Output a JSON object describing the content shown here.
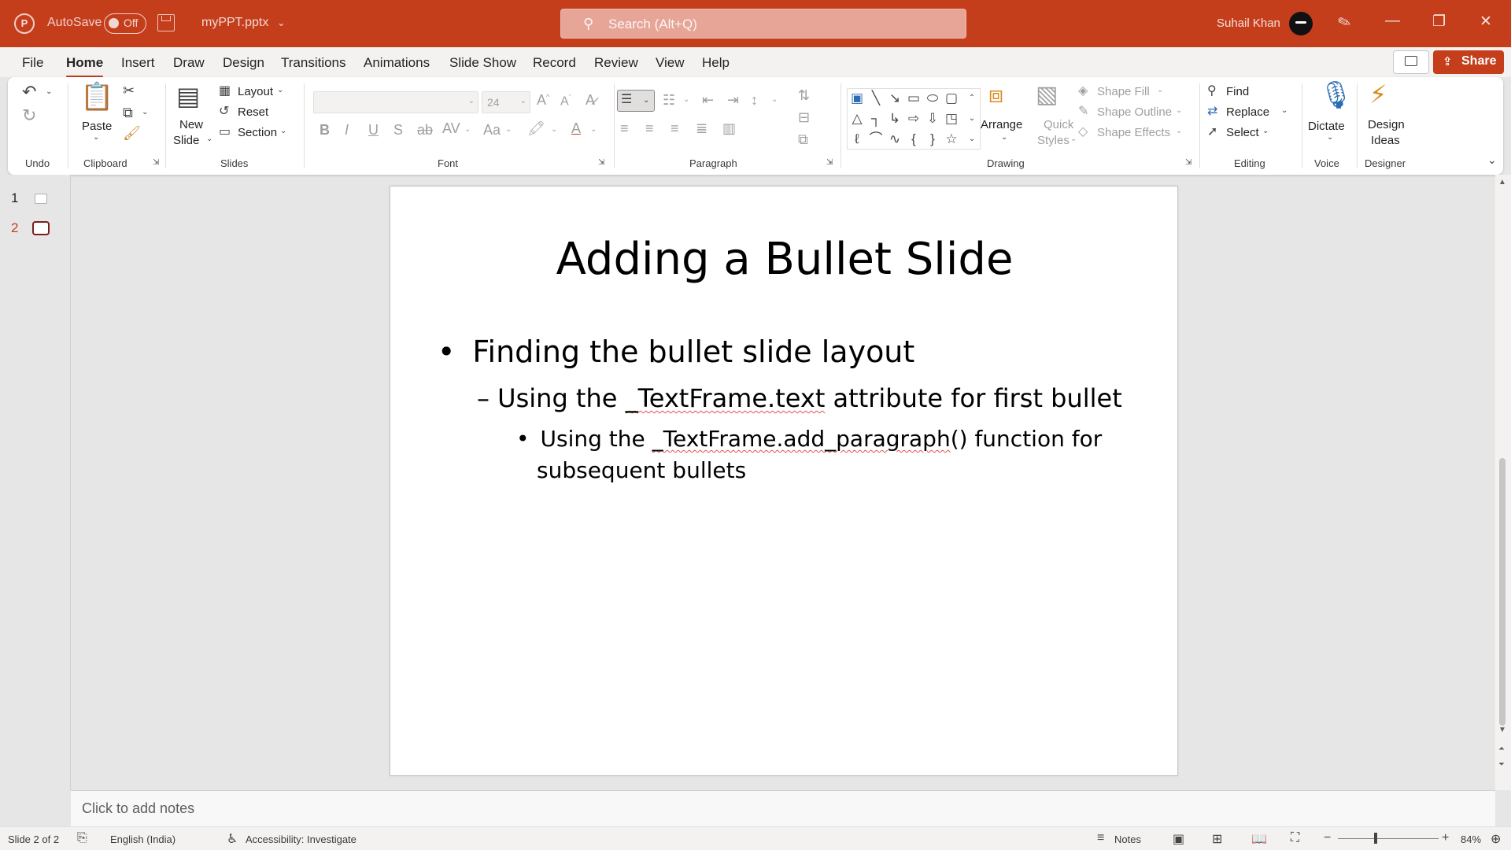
{
  "titlebar": {
    "app_icon": "P",
    "autosave_label": "AutoSave",
    "autosave_state": "Off",
    "filename": "myPPT.pptx",
    "filename_caret": "⌄",
    "search_placeholder": "Search (Alt+Q)",
    "user_name": "Suhail Khan",
    "accent_color": "#c43e1c"
  },
  "menu": {
    "tabs": [
      "File",
      "Home",
      "Insert",
      "Draw",
      "Design",
      "Transitions",
      "Animations",
      "Slide Show",
      "Record",
      "Review",
      "View",
      "Help"
    ],
    "active_tab": "Home",
    "share_label": "Share"
  },
  "ribbon": {
    "undo_group": "Undo",
    "clipboard": {
      "label": "Clipboard",
      "paste": "Paste"
    },
    "slides": {
      "label": "Slides",
      "new_slide_1": "New",
      "new_slide_2": "Slide",
      "layout": "Layout",
      "reset": "Reset",
      "section": "Section"
    },
    "font": {
      "label": "Font",
      "font_size": "24"
    },
    "paragraph": {
      "label": "Paragraph"
    },
    "drawing": {
      "label": "Drawing",
      "arrange": "Arrange",
      "quick_styles_1": "Quick",
      "quick_styles_2": "Styles",
      "shape_fill": "Shape Fill",
      "shape_outline": "Shape Outline",
      "shape_effects": "Shape Effects"
    },
    "editing": {
      "label": "Editing",
      "find": "Find",
      "replace": "Replace",
      "select": "Select"
    },
    "voice": {
      "label": "Voice",
      "dictate": "Dictate"
    },
    "designer": {
      "label": "Designer",
      "design_ideas_1": "Design",
      "design_ideas_2": "Ideas"
    }
  },
  "thumbnails": [
    {
      "number": "1",
      "selected": false
    },
    {
      "number": "2",
      "selected": true
    }
  ],
  "slide": {
    "title": "Adding a Bullet Slide",
    "bullet_1": "Finding the bullet slide layout",
    "bullet_2_pre": "– Using the ",
    "bullet_2_code": "_TextFrame.text",
    "bullet_2_post": " attribute for first bullet",
    "bullet_3_pre": "Using the ",
    "bullet_3_code": "_TextFrame.add_paragraph",
    "bullet_3_post": "() function for",
    "bullet_3_line2": "subsequent bullets"
  },
  "notes_placeholder": "Click to add notes",
  "status": {
    "slide_count": "Slide 2 of 2",
    "language": "English (India)",
    "accessibility": "Accessibility: Investigate",
    "notes": "Notes",
    "zoom": "84%"
  }
}
